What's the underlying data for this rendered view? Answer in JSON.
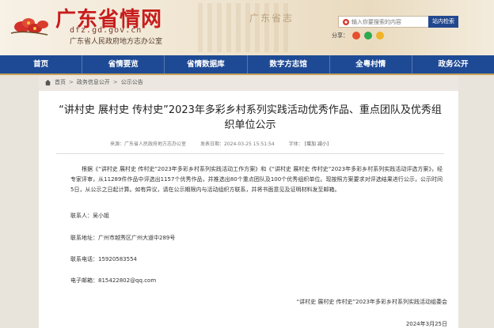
{
  "header": {
    "site_title": "广东省情网",
    "domain": "dfz.gd.gov.cn",
    "org": "广东省人民政府地方志办公室",
    "stamp": "广东省志",
    "search_placeholder": "输入你要搜索的内容",
    "search_button": "站内检索",
    "share_label": "分享："
  },
  "nav": {
    "items": [
      "首页",
      "省情要览",
      "省情数据库",
      "数字方志馆",
      "全粤村情",
      "政务公开"
    ]
  },
  "breadcrumb": {
    "home": "首页",
    "sep1": ">",
    "level1": "政务信息公开",
    "sep2": ">",
    "level2": "公示公告"
  },
  "article": {
    "title": "“讲村史 展村史 传村史”2023年多彩乡村系列实践活动优秀作品、重点团队及优秀组织单位公示",
    "source": "来源：广东省人民政府地方志办公室",
    "published": "发表日期：2024-03-25 15:51:54",
    "font_size_label": "字体：",
    "font_size_ctrl": "[增加 减小]",
    "body": "根据《“讲村史 展村史 传村史”2023年多彩乡村系列实践活动工作方案》和《“讲村史 展村史 传村史”2023年多彩乡村系列实践活动评选方案》，经专家评审，从11289件作品中评选出1157个优秀作品，并推选出80个重点团队及100个优秀组织单位。现按照方案要求对评选结果进行公示，公示时间5日，从公示之日起计算。如有异议，请在公示期限内与活动组织方联系，并将书面意见及证明材料发至邮箱。",
    "contact": "联系人：吴小姐",
    "address": "联系地址：广州市越秀区广州大道中289号",
    "phone": "联系电话：15920583554",
    "email": "电子邮箱：815422802@qq.com",
    "signoff_org": "“讲村史 展村史 传村史”2023年多彩乡村系列实践活动组委会",
    "signoff_date": "2024年3月25日"
  },
  "colors": {
    "nav_bg": "#1e4a95",
    "title_red": "#c81c1c",
    "search_btn": "#23488f"
  }
}
